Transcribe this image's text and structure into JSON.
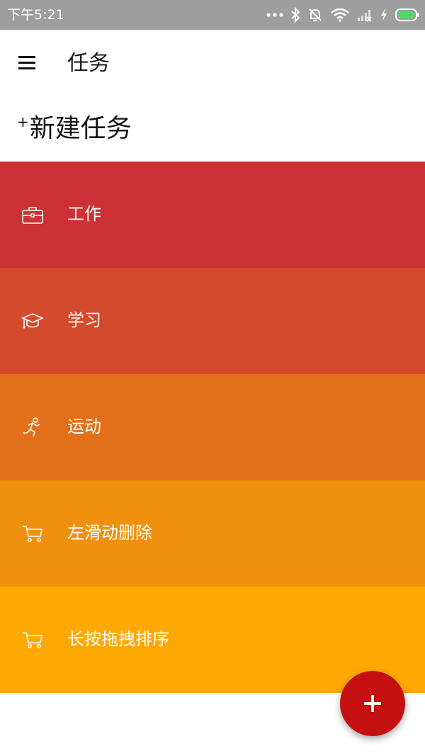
{
  "status_bar": {
    "time": "下午5:21",
    "icons": [
      "more-dots-icon",
      "bluetooth-icon",
      "alarm-off-icon",
      "wifi-icon",
      "signal-icon",
      "charging-icon",
      "battery-icon"
    ]
  },
  "app_bar": {
    "menu_icon": "hamburger-menu-icon",
    "title": "任务"
  },
  "new_task": {
    "plus": "+",
    "label": "新建任务"
  },
  "categories": [
    {
      "label": "工作",
      "icon": "briefcase-icon",
      "color": "#cc3135"
    },
    {
      "label": "学习",
      "icon": "graduation-cap-icon",
      "color": "#d44a2c"
    },
    {
      "label": "运动",
      "icon": "running-icon",
      "color": "#e2701b"
    },
    {
      "label": "左滑动删除",
      "icon": "cart-icon",
      "color": "#f0900f"
    },
    {
      "label": "长按拖拽排序",
      "icon": "cart-icon",
      "color": "#fea804"
    }
  ],
  "fab": {
    "icon": "plus-icon",
    "color": "#c41010"
  }
}
